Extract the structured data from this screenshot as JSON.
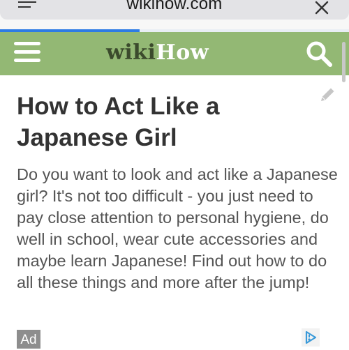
{
  "browser": {
    "url": "wikihow.com",
    "load_progress": 0.4,
    "icons": {
      "menu": "menu-lines-icon",
      "close": "close-x-icon"
    }
  },
  "header": {
    "logo_part1": "wiki",
    "logo_part2": "How",
    "background_color": "#93b874",
    "icons": {
      "menu": "hamburger-icon",
      "search": "search-icon"
    }
  },
  "article": {
    "title": "How to Act Like a Japanese Girl",
    "intro": "Do you want to look and act like a Japanese girl? It's not too difficult - you just need to pay close attention to personal hygiene, do well in school, wear cute accessories and maybe learn Japanese! Find out how to do all these things and more after the jump!",
    "edit_icon": "pencil-icon"
  },
  "ad": {
    "badge": "Ad",
    "choices_icon": "adchoices-icon"
  }
}
